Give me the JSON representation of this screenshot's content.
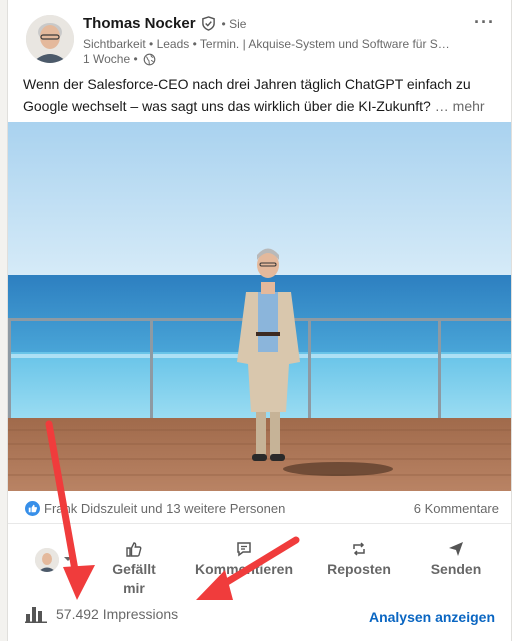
{
  "post": {
    "author_name": "Thomas Nocker",
    "author_you": "• Sie",
    "author_headline": "Sichtbarkeit • Leads • Termin. | Akquise-System und Software für Sel...",
    "time": "1 Woche •",
    "text": "Wenn der Salesforce-CEO nach drei Jahren täglich ChatGPT einfach zu Google wechselt – was sagt uns das wirklich über die KI-Zukunft?",
    "see_more": "… mehr",
    "more_menu": "···"
  },
  "social": {
    "reactions": "Frank Didszuleit und 13 weitere Personen",
    "comments": "6 Kommentare"
  },
  "actions": {
    "like": "Gefällt mir",
    "comment": "Kommentieren",
    "repost": "Reposten",
    "send": "Senden"
  },
  "footer": {
    "impressions": "57.492 Impressions",
    "analytics": "Analysen anzeigen"
  },
  "colors": {
    "accent": "#0a66c2",
    "annotation_arrow": "#f03c3c"
  },
  "icons": [
    "verified-shield-icon",
    "globe-icon",
    "like-icon",
    "comment-icon",
    "repost-icon",
    "send-icon",
    "bar-chart-icon"
  ]
}
